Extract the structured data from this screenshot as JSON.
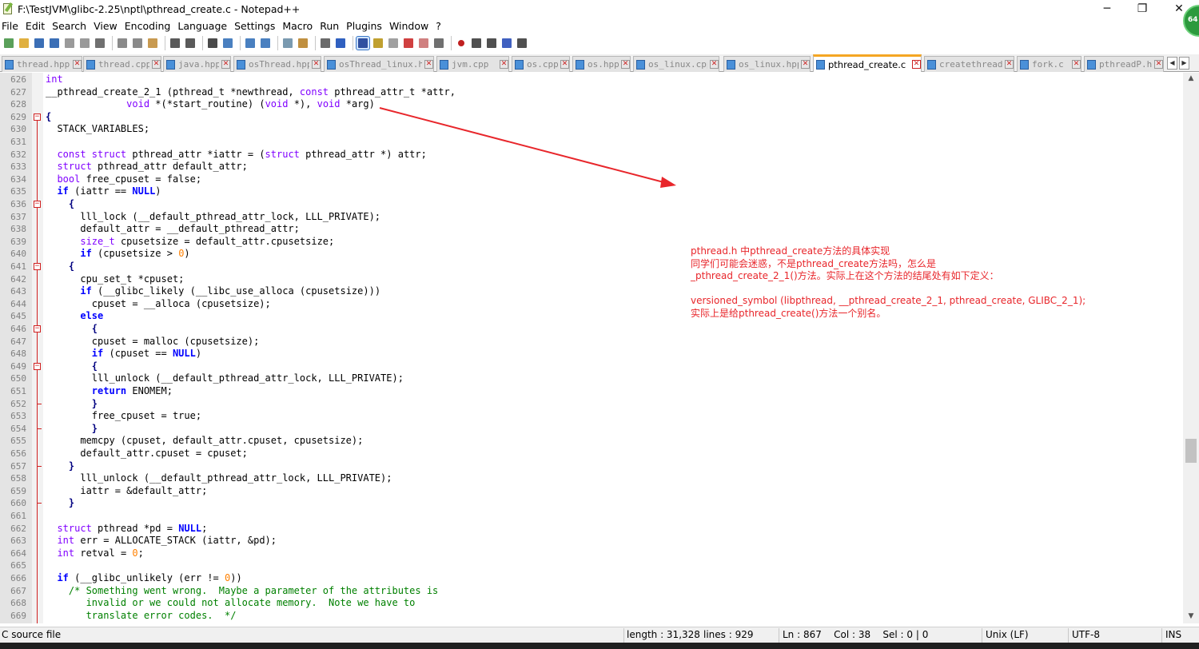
{
  "window": {
    "title": "F:\\TestJVM\\glibc-2.25\\nptl\\pthread_create.c - Notepad++",
    "minimize": "─",
    "maximize": "❐",
    "close": "✕",
    "badge": "64"
  },
  "menu": [
    "File",
    "Edit",
    "Search",
    "View",
    "Encoding",
    "Language",
    "Settings",
    "Macro",
    "Run",
    "Plugins",
    "Window",
    "?"
  ],
  "toolbar_icons": [
    "new-file-icon",
    "open-file-icon",
    "save-icon",
    "save-all-icon",
    "close-icon",
    "close-all-icon",
    "print-icon",
    "|",
    "cut-icon",
    "copy-icon",
    "paste-icon",
    "|",
    "undo-icon",
    "redo-icon",
    "|",
    "find-icon",
    "replace-icon",
    "|",
    "zoom-in-icon",
    "zoom-out-icon",
    "|",
    "sync-vertical-icon",
    "sync-horizontal-icon",
    "|",
    "word-wrap-icon",
    "show-all-chars-icon",
    "|",
    "indent-guide-icon",
    "user-language-icon",
    "doc-map-icon",
    "function-list-icon",
    "folder-workspace-icon",
    "monitor-icon",
    "|",
    "record-macro-icon",
    "stop-macro-icon",
    "play-macro-icon",
    "run-macro-multiple-icon",
    "save-macro-icon"
  ],
  "tabs": [
    {
      "label": "thread.hpp",
      "active": false
    },
    {
      "label": "thread.cpp",
      "active": false
    },
    {
      "label": "java.hpp",
      "active": false
    },
    {
      "label": "osThread.hpp",
      "active": false
    },
    {
      "label": "osThread_linux.hpp",
      "active": false
    },
    {
      "label": "jvm.cpp",
      "active": false
    },
    {
      "label": "os.cpp",
      "active": false
    },
    {
      "label": "os.hpp",
      "active": false
    },
    {
      "label": "os_linux.cpp",
      "active": false
    },
    {
      "label": "os_linux.hpp",
      "active": false
    },
    {
      "label": "pthread_create.c",
      "active": true
    },
    {
      "label": "createthread.c",
      "active": false
    },
    {
      "label": "fork.c",
      "active": false
    },
    {
      "label": "pthreadP.h",
      "active": false
    }
  ],
  "tab_close_glyph": "✕",
  "tab_scroll": {
    "left": "◀",
    "right": "▶"
  },
  "code_lines": [
    {
      "n": "626",
      "f": "",
      "h": "<span class=\"ty\">int</span>"
    },
    {
      "n": "627",
      "f": "",
      "h": "__pthread_create_2_1 (pthread_t *newthread, <span class=\"ty\">const</span> pthread_attr_t *attr,"
    },
    {
      "n": "628",
      "f": "",
      "h": "              <span class=\"ty\">void</span> *(*start_routine) (<span class=\"ty\">void</span> *), <span class=\"ty\">void</span> *arg)"
    },
    {
      "n": "629",
      "f": "box",
      "h": "<span class=\"op\">{</span>"
    },
    {
      "n": "630",
      "f": "",
      "h": "  STACK_VARIABLES;"
    },
    {
      "n": "631",
      "f": "",
      "h": ""
    },
    {
      "n": "632",
      "f": "",
      "h": "  <span class=\"ty\">const struct</span> pthread_attr *iattr = (<span class=\"ty\">struct</span> pthread_attr *) attr;"
    },
    {
      "n": "633",
      "f": "",
      "h": "  <span class=\"ty\">struct</span> pthread_attr default_attr;"
    },
    {
      "n": "634",
      "f": "",
      "h": "  <span class=\"ty\">bool</span> free_cpuset = false;"
    },
    {
      "n": "635",
      "f": "",
      "h": "  <span class=\"kw\">if</span> (iattr == <span class=\"kw\">NULL</span>)"
    },
    {
      "n": "636",
      "f": "box",
      "h": "    <span class=\"op\">{</span>"
    },
    {
      "n": "637",
      "f": "",
      "h": "      lll_lock (__default_pthread_attr_lock, LLL_PRIVATE);"
    },
    {
      "n": "638",
      "f": "",
      "h": "      default_attr = __default_pthread_attr;"
    },
    {
      "n": "639",
      "f": "",
      "h": "      <span class=\"ty\">size_t</span> cpusetsize = default_attr.cpusetsize;"
    },
    {
      "n": "640",
      "f": "",
      "h": "      <span class=\"kw\">if</span> (cpusetsize > <span class=\"num\">0</span>)"
    },
    {
      "n": "641",
      "f": "box",
      "h": "    <span class=\"op\">{</span>"
    },
    {
      "n": "642",
      "f": "",
      "h": "      cpu_set_t *cpuset;"
    },
    {
      "n": "643",
      "f": "",
      "h": "      <span class=\"kw\">if</span> (__glibc_likely (__libc_use_alloca (cpusetsize)))"
    },
    {
      "n": "644",
      "f": "",
      "h": "        cpuset = __alloca (cpusetsize);"
    },
    {
      "n": "645",
      "f": "",
      "h": "      <span class=\"kw\">else</span>"
    },
    {
      "n": "646",
      "f": "box",
      "h": "        <span class=\"op\">{</span>"
    },
    {
      "n": "647",
      "f": "",
      "h": "        cpuset = malloc (cpusetsize);"
    },
    {
      "n": "648",
      "f": "",
      "h": "        <span class=\"kw\">if</span> (cpuset == <span class=\"kw\">NULL</span>)"
    },
    {
      "n": "649",
      "f": "box",
      "h": "        <span class=\"op\">{</span>"
    },
    {
      "n": "650",
      "f": "",
      "h": "        lll_unlock (__default_pthread_attr_lock, LLL_PRIVATE);"
    },
    {
      "n": "651",
      "f": "",
      "h": "        <span class=\"kw\">return</span> ENOMEM;"
    },
    {
      "n": "652",
      "f": "end",
      "h": "        <span class=\"op\">}</span>"
    },
    {
      "n": "653",
      "f": "",
      "h": "        free_cpuset = true;"
    },
    {
      "n": "654",
      "f": "end",
      "h": "        <span class=\"op\">}</span>"
    },
    {
      "n": "655",
      "f": "",
      "h": "      memcpy (cpuset, default_attr.cpuset, cpusetsize);"
    },
    {
      "n": "656",
      "f": "",
      "h": "      default_attr.cpuset = cpuset;"
    },
    {
      "n": "657",
      "f": "end",
      "h": "    <span class=\"op\">}</span>"
    },
    {
      "n": "658",
      "f": "",
      "h": "      lll_unlock (__default_pthread_attr_lock, LLL_PRIVATE);"
    },
    {
      "n": "659",
      "f": "",
      "h": "      iattr = &default_attr;"
    },
    {
      "n": "660",
      "f": "end",
      "h": "    <span class=\"op\">}</span>"
    },
    {
      "n": "661",
      "f": "",
      "h": ""
    },
    {
      "n": "662",
      "f": "",
      "h": "  <span class=\"ty\">struct</span> pthread *pd = <span class=\"kw\">NULL</span>;"
    },
    {
      "n": "663",
      "f": "",
      "h": "  <span class=\"ty\">int</span> err = ALLOCATE_STACK (iattr, &pd);"
    },
    {
      "n": "664",
      "f": "",
      "h": "  <span class=\"ty\">int</span> retval = <span class=\"num\">0</span>;"
    },
    {
      "n": "665",
      "f": "",
      "h": ""
    },
    {
      "n": "666",
      "f": "",
      "h": "  <span class=\"kw\">if</span> (__glibc_unlikely (err != <span class=\"num\">0</span>))"
    },
    {
      "n": "667",
      "f": "",
      "h": "    <span class=\"cm\">/* Something went wrong.  Maybe a parameter of the attributes is</span>"
    },
    {
      "n": "668",
      "f": "",
      "h": "<span class=\"cm\">       invalid or we could not allocate memory.  Note we have to</span>"
    },
    {
      "n": "669",
      "f": "",
      "h": "<span class=\"cm\">       translate error codes.  */</span>"
    }
  ],
  "annotation": "pthread.h 中pthread_create方法的具体实现\n同学们可能会迷惑，不是pthread_create方法吗，怎么是\n_pthread_create_2_1()方法。实际上在这个方法的结尾处有如下定义：\n\nversioned_symbol (libpthread, __pthread_create_2_1, pthread_create, GLIBC_2_1);\n实际上是给pthread_create()方法一个别名。",
  "scroll": {
    "up": "▲",
    "down": "▼"
  },
  "status": {
    "file_type": "C source file",
    "length": "length : 31,328",
    "lines": "lines : 929",
    "position": "Ln : 867    Col : 38    Sel : 0 | 0",
    "eol": "Unix (LF)",
    "encoding": "UTF-8",
    "mode": "INS"
  },
  "colors": {
    "annotation": "#e8262b",
    "active_tab_accent": "#f5a623",
    "keyword": "#0000ff",
    "type": "#8000ff",
    "number": "#ff8000",
    "comment": "#008000"
  }
}
